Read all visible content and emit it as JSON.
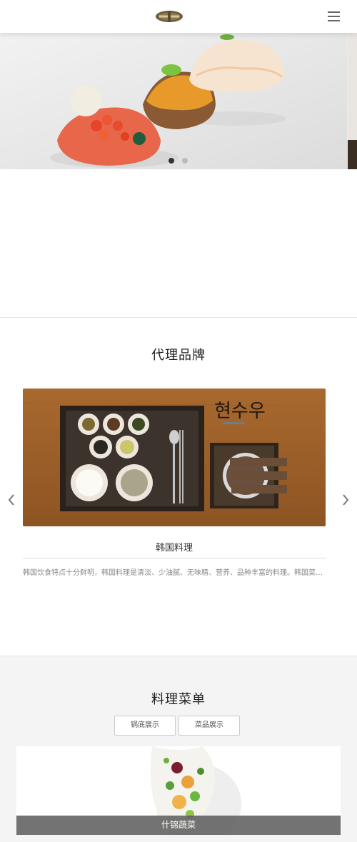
{
  "header": {
    "logo_icon": "brand-logo-icon",
    "menu_icon": "hamburger-menu-icon"
  },
  "hero": {
    "slide_count": 2,
    "active_slide": 1
  },
  "brand_section": {
    "title": "代理品牌",
    "item_name": "韩国料理",
    "item_desc": "韩国饮食特点十分鲜明，韩国料理是清淡、少油腻、无味精、营养、品种丰富的料理。韩国菜…",
    "prev_icon": "chevron-left-icon",
    "next_icon": "chevron-right-icon"
  },
  "menu_section": {
    "title": "料理菜单",
    "tabs": [
      {
        "label": "锅底展示"
      },
      {
        "label": "菜品展示"
      }
    ],
    "dish_caption": "什锦蔬菜"
  },
  "colors": {
    "accent_dark": "#333333",
    "dot_inactive": "#bbbbbb",
    "section_bg": "#f4f4f4"
  }
}
